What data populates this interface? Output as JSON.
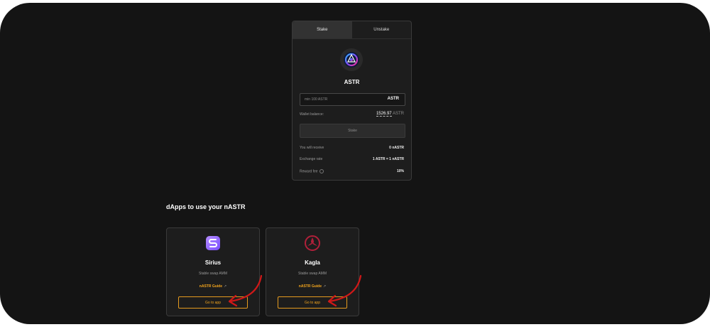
{
  "stake_card": {
    "tabs": [
      "Stake",
      "Unstake"
    ],
    "token": "ASTR",
    "amount_placeholder": "min 100 ASTR",
    "amount_symbol": "ASTR",
    "wallet_balance_label": "Wallet balance:",
    "wallet_balance_value": "1526.97",
    "wallet_balance_unit": "ASTR",
    "stake_button": "Stake",
    "you_will_receive_label": "You will receive",
    "you_will_receive_value": "0 nASTR",
    "exchange_rate_label": "Exchange rate",
    "exchange_rate_value": "1 ASTR = 1 nASTR",
    "reward_fee_label": "Reward fee",
    "reward_fee_value": "10%"
  },
  "dapps_section": {
    "title": "dApps to use your nASTR",
    "items": [
      {
        "name": "Sirius",
        "description": "Stable swap AMM",
        "guide": "nASTR Guide",
        "button": "Go to app",
        "icon": "sirius-logo"
      },
      {
        "name": "Kagla",
        "description": "Stable swap AMM",
        "guide": "nASTR Guide",
        "button": "Go to app",
        "icon": "kagla-logo"
      }
    ]
  },
  "colors": {
    "accent": "#f4a51c",
    "annotation": "#d01818",
    "background": "#141414",
    "card": "#1d1d1d"
  },
  "icons": [
    "astar-logo-icon",
    "external-link-icon",
    "info-icon",
    "red-arrow-annotation"
  ]
}
